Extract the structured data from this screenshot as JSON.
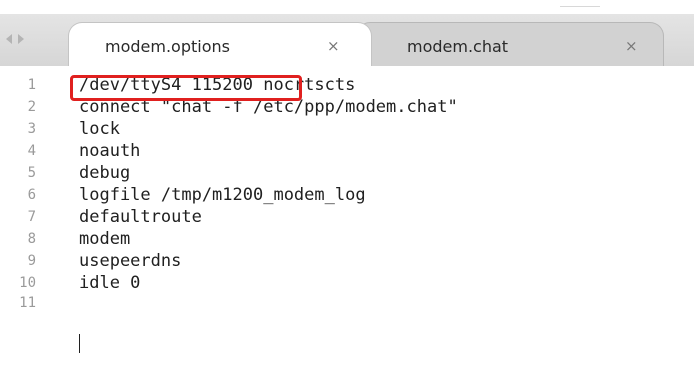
{
  "tabs": [
    {
      "label": "modem.options",
      "close": "×",
      "active": true
    },
    {
      "label": "modem.chat",
      "close": "×",
      "active": false
    }
  ],
  "nav_icons": [
    "arrow-left-icon",
    "arrow-right-icon"
  ],
  "editor": {
    "lines": [
      {
        "number": "1",
        "text": "/dev/ttyS4 115200 nocrtscts"
      },
      {
        "number": "2",
        "text": "connect \"chat -f /etc/ppp/modem.chat\""
      },
      {
        "number": "3",
        "text": "lock"
      },
      {
        "number": "4",
        "text": "noauth"
      },
      {
        "number": "5",
        "text": "debug"
      },
      {
        "number": "6",
        "text": "logfile /tmp/m1200_modem_log"
      },
      {
        "number": "7",
        "text": "defaultroute"
      },
      {
        "number": "8",
        "text": "modem"
      },
      {
        "number": "9",
        "text": "usepeerdns"
      },
      {
        "number": "10",
        "text": "idle 0"
      },
      {
        "number": "11",
        "text": ""
      }
    ]
  },
  "colors": {
    "highlight_border": "#e0201f",
    "text": "#202020",
    "line_number": "#9a9a9a",
    "tab_active": "#ffffff",
    "tab_inactive": "#d2d2d2"
  }
}
